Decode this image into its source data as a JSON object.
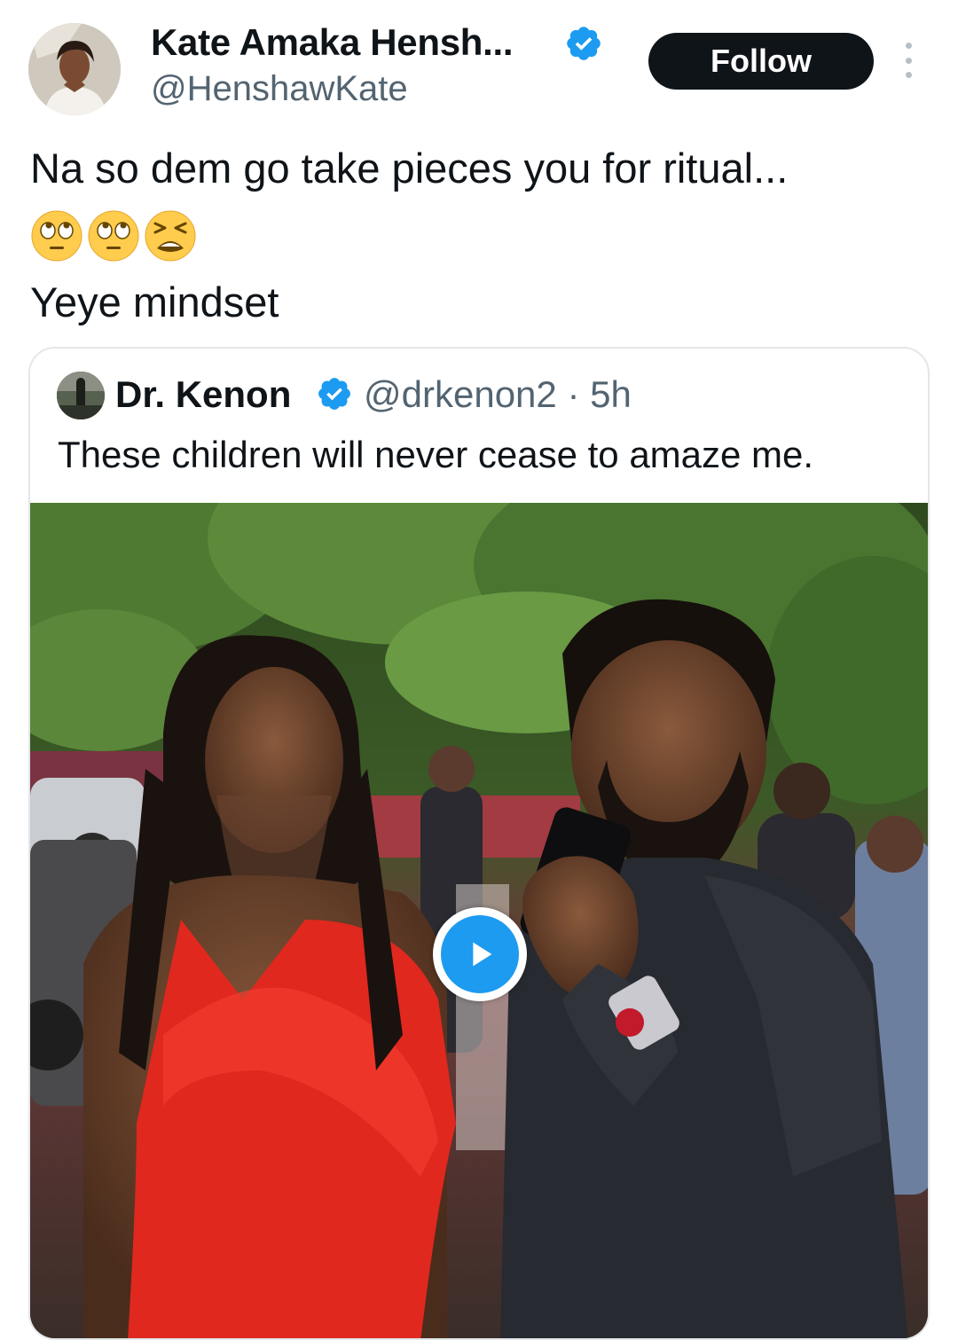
{
  "author": {
    "name": "Kate Amaka Hensh...",
    "handle": "@HenshawKate",
    "verified": true
  },
  "follow_label": "Follow",
  "tweet": {
    "line1": "Na so dem go take pieces you for ritual...",
    "emojis": [
      "face-with-rolling-eyes",
      "face-with-rolling-eyes",
      "tired-face"
    ],
    "line2": "Yeye mindset"
  },
  "quote": {
    "name": "Dr. Kenon",
    "handle_time": "@drkenon2 · 5h",
    "text": "These children will never cease to amaze me.",
    "media_type": "video"
  },
  "colors": {
    "verified": "#1d9bf0",
    "follow_bg": "#0f1419",
    "secondary_text": "#536471",
    "play": "#1d9bf0"
  }
}
